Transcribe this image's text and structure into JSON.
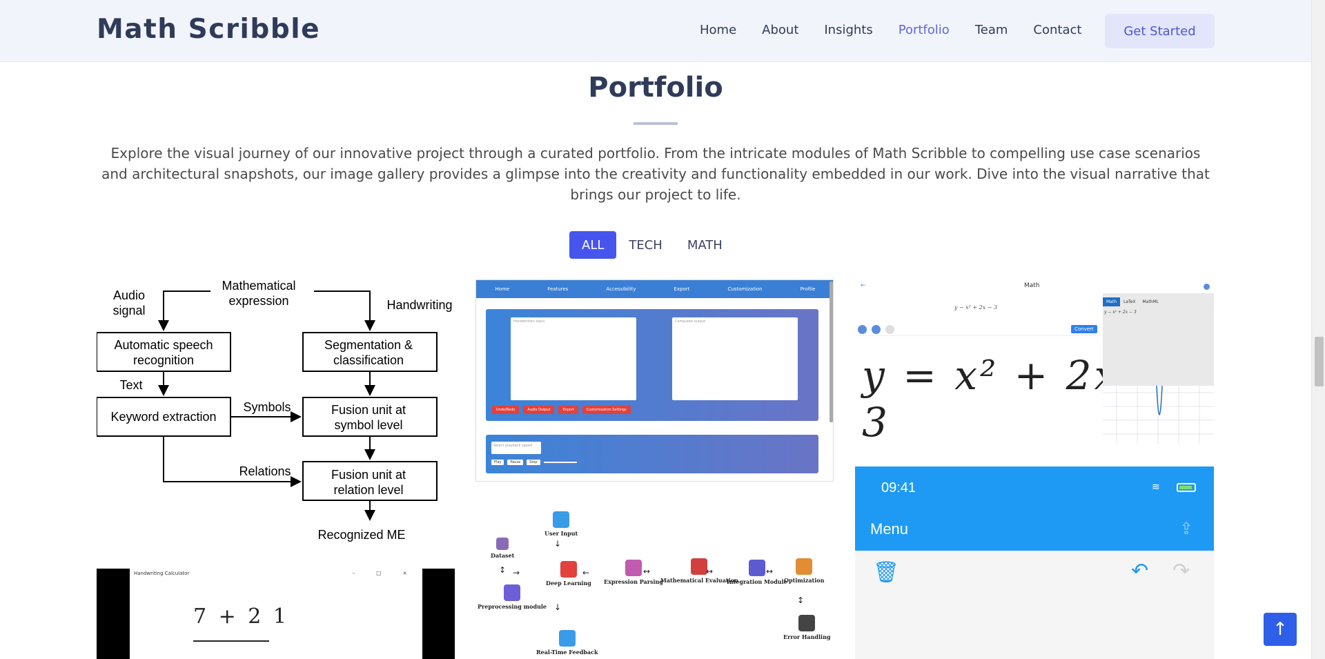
{
  "header": {
    "logo": "Math Scribble",
    "nav": [
      "Home",
      "About",
      "Insights",
      "Portfolio",
      "Team",
      "Contact"
    ],
    "active_nav": "Portfolio",
    "cta": "Get Started"
  },
  "section": {
    "title": "Portfolio",
    "description": "Explore the visual journey of our innovative project through a curated portfolio. From the intricate modules of Math Scribble to compelling use case scenarios and architectural snapshots, our image gallery provides a glimpse into the creativity and functionality embedded in our work. Dive into the visual narrative that brings our project to life.",
    "filters": [
      "ALL",
      "TECH",
      "MATH"
    ],
    "active_filter": "ALL"
  },
  "items": {
    "flow": {
      "top": "Mathematical\nexpression",
      "audio": "Audio\nsignal",
      "handwriting": "Handwriting",
      "asr": "Automatic speech\nrecognition",
      "seg": "Segmentation &\nclassification",
      "text": "Text",
      "kw": "Keyword extraction",
      "symbols": "Symbols",
      "fus_sym": "Fusion unit at\nsymbol level",
      "relations": "Relations",
      "fus_rel": "Fusion unit at\nrelation level",
      "out": "Recognized ME"
    },
    "webapp": {
      "nav": [
        "Home",
        "Features",
        "Accessibility",
        "Export",
        "Customization",
        "Profile"
      ],
      "box1": "Handwritten input",
      "box2": "Computed output",
      "buttons": [
        "Undo/Redo",
        "Audio Output",
        "Export",
        "Customization Settings"
      ],
      "playback_placeholder": "Select playback speed",
      "controls": [
        "Play",
        "Pause",
        "Stop"
      ]
    },
    "mathapp": {
      "back": "←",
      "title": "Math",
      "equation": "y − x² + 2x − 3",
      "convert": "Convert",
      "handwritten": "y = x² + 2x − 3",
      "tabs": [
        "Math",
        "LaTeX",
        "MathML"
      ],
      "code": "y − x² + 2x − 3"
    },
    "calculator": {
      "window_title": "Handwriting Calculator",
      "window_controls": "–  □  ×",
      "handwritten": "7 + 2 1"
    },
    "architecture": {
      "nodes": [
        "User Input",
        "Dataset",
        "Deep Learning",
        "Preprocessing module",
        "Expression Parsing",
        "Mathematical Evaluation",
        "Integration Module",
        "Optimization",
        "Real-Time Feedback",
        "Error Handling"
      ],
      "colors": [
        "#3a9be8",
        "#8a6bb5",
        "#e2413c",
        "#6f5fd6",
        "#c05bb0",
        "#d23f3f",
        "#5c5cd0",
        "#e28c34",
        "#3a9be8",
        "#444444"
      ]
    },
    "phone": {
      "time": "09:41",
      "menu": "Menu",
      "status_icons": "wifi-icon",
      "color_top": "#1e9af5"
    }
  },
  "scroll_top": "↑"
}
